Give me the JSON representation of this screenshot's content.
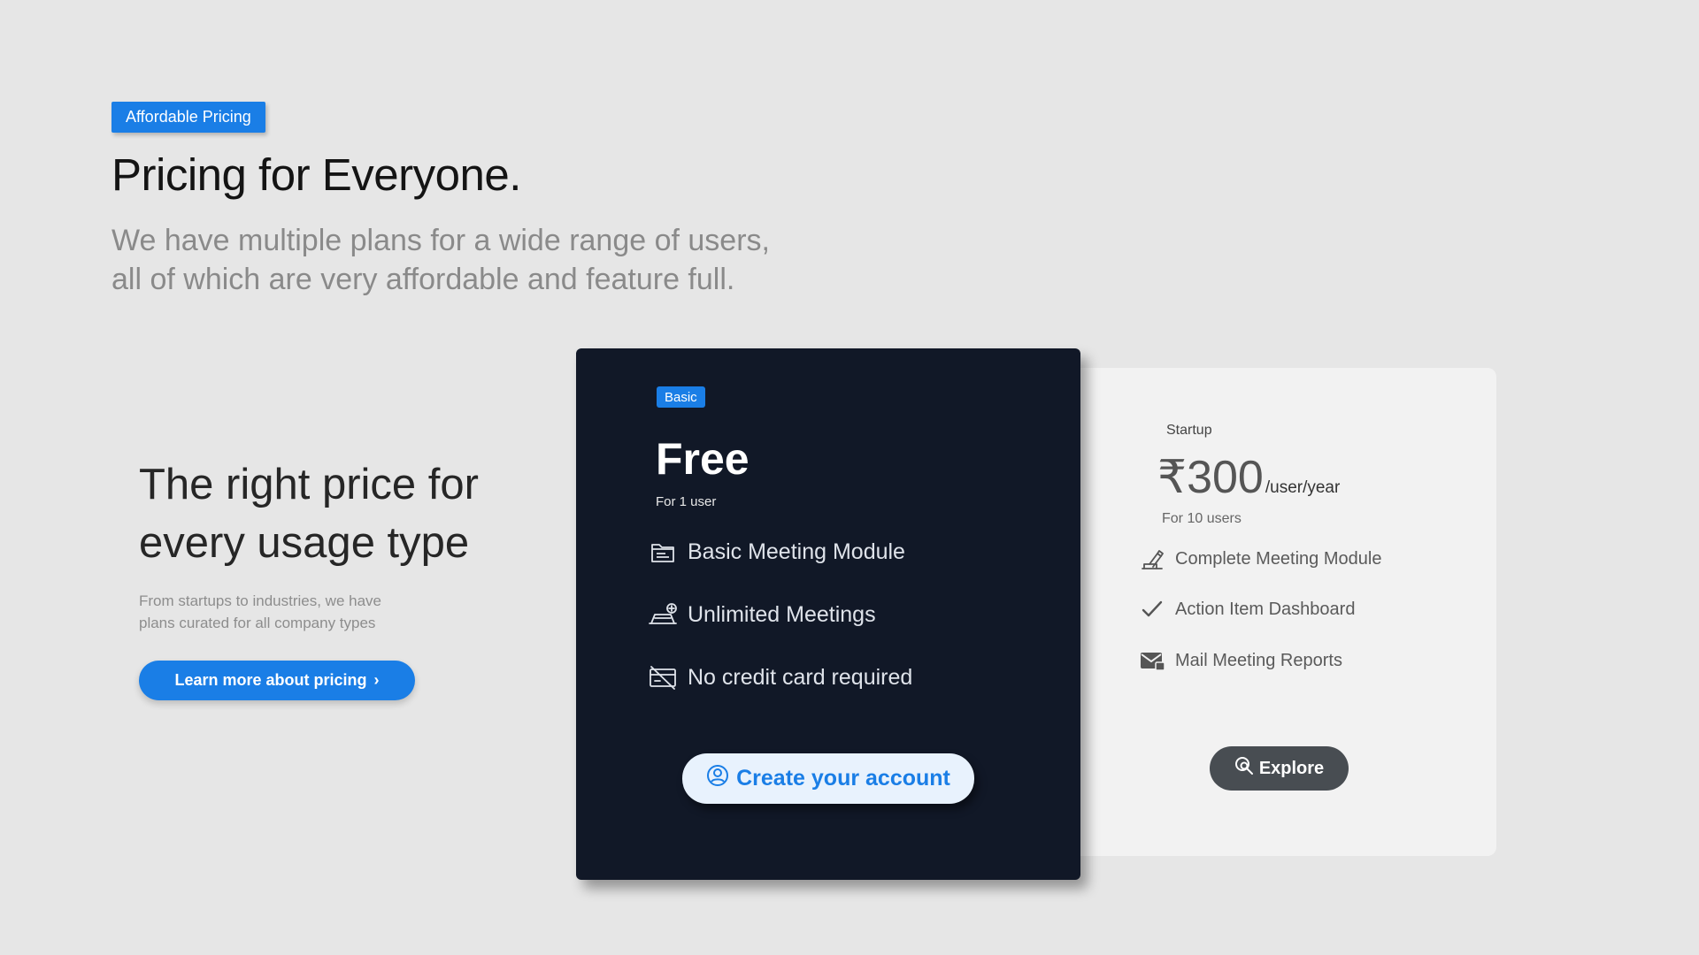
{
  "hero": {
    "tag": "Affordable Pricing",
    "title": "Pricing for Everyone.",
    "subtitle_line1": "We have multiple plans for a wide range of users,",
    "subtitle_line2": "all of which are very affordable and feature full."
  },
  "intro": {
    "heading_line1": "The right price for",
    "heading_line2": "every usage type",
    "text_line1": "From startups to industries, we have",
    "text_line2": "plans curated for all company types",
    "cta_label": "Learn more about pricing",
    "cta_chevron": "›"
  },
  "plans": {
    "basic": {
      "badge": "Basic",
      "price": "Free",
      "users": "For 1 user",
      "features": [
        {
          "icon": "meeting-module-icon",
          "label": "Basic Meeting Module"
        },
        {
          "icon": "unlimited-meetings-icon",
          "label": "Unlimited Meetings"
        },
        {
          "icon": "no-credit-card-icon",
          "label": "No credit card required"
        }
      ],
      "button_label": "Create your account",
      "button_icon": "user-circle-icon"
    },
    "startup": {
      "name": "Startup",
      "price": "₹300",
      "price_unit": "/user/year",
      "users": "For 10 users",
      "features": [
        {
          "icon": "meeting-edit-icon",
          "label": "Complete Meeting Module"
        },
        {
          "icon": "check-icon",
          "label": "Action Item Dashboard"
        },
        {
          "icon": "mail-icon",
          "label": "Mail Meeting Reports"
        }
      ],
      "button_label": "Explore",
      "button_icon": "explore-search-icon"
    }
  },
  "colors": {
    "background": "#e6e6e6",
    "accent": "#1a7ee6",
    "dark_card": "#111827",
    "light_card": "#f2f2f2",
    "explore_button": "#484d52"
  }
}
